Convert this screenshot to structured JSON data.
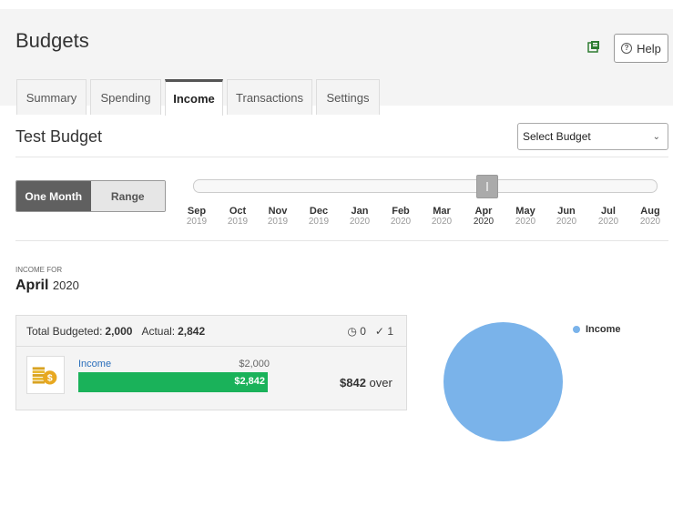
{
  "header": {
    "title": "Budgets",
    "help_label": "Help",
    "help_icon": "help-circle-icon",
    "ext_icon": "open-external-icon"
  },
  "tabs": [
    {
      "label": "Summary",
      "active": false
    },
    {
      "label": "Spending",
      "active": false
    },
    {
      "label": "Income",
      "active": true
    },
    {
      "label": "Transactions",
      "active": false
    },
    {
      "label": "Settings",
      "active": false
    }
  ],
  "budget": {
    "name": "Test Budget",
    "select_placeholder": "Select Budget"
  },
  "mode_toggle": {
    "one_month": "One Month",
    "range": "Range",
    "selected": "One Month"
  },
  "months": [
    {
      "m": "Sep",
      "y": "2019"
    },
    {
      "m": "Oct",
      "y": "2019"
    },
    {
      "m": "Nov",
      "y": "2019"
    },
    {
      "m": "Dec",
      "y": "2019"
    },
    {
      "m": "Jan",
      "y": "2020"
    },
    {
      "m": "Feb",
      "y": "2020"
    },
    {
      "m": "Mar",
      "y": "2020"
    },
    {
      "m": "Apr",
      "y": "2020"
    },
    {
      "m": "May",
      "y": "2020"
    },
    {
      "m": "Jun",
      "y": "2020"
    },
    {
      "m": "Jul",
      "y": "2020"
    },
    {
      "m": "Aug",
      "y": "2020"
    }
  ],
  "selected_month": "Apr",
  "period": {
    "label": "INCOME FOR",
    "month": "April",
    "year": "2020"
  },
  "summary": {
    "total_budgeted_label": "Total Budgeted:",
    "total_budgeted": "2,000",
    "actual_label": "Actual:",
    "actual": "2,842",
    "pending_icon": "clock-icon",
    "pending_count": "0",
    "done_icon": "check-icon",
    "done_count": "1"
  },
  "category": {
    "icon": "coins-icon",
    "name": "Income",
    "budgeted": "$2,000",
    "actual": "$2,842",
    "progress_fraction": 1.0,
    "over_amount": "$842",
    "over_label": "over"
  },
  "pie": {
    "legend": "Income",
    "color": "#7ab3ea",
    "share": 1.0
  },
  "colors": {
    "accent_bar": "#1ab25a",
    "link": "#2a6ebb"
  }
}
